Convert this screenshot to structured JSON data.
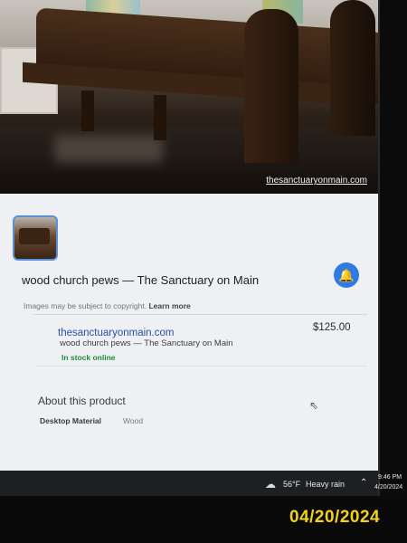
{
  "image": {
    "credit_link": "thesanctuaryonmain.com"
  },
  "product": {
    "title": "wood church pews — The Sanctuary on Main",
    "copyright_notice": "Images may be subject to copyright.",
    "learn_more": "Learn more"
  },
  "offer": {
    "site": "thesanctuaryonmain.com",
    "description": "wood church pews — The Sanctuary on Main",
    "stock": "In stock online",
    "price": "$125.00"
  },
  "about": {
    "heading": "About this product",
    "specs": [
      {
        "label": "Desktop Material",
        "value": "Wood"
      }
    ]
  },
  "taskbar": {
    "temperature": "56°F",
    "weather": "Heavy rain",
    "time": "9:46 PM",
    "date": "4/20/2024"
  },
  "photo_stamp": "04/20/2024",
  "colors": {
    "accent": "#2f7ae5",
    "link": "#2a4fa8",
    "stock_green": "#1e8e3e",
    "stamp_yellow": "#f2d21b"
  }
}
